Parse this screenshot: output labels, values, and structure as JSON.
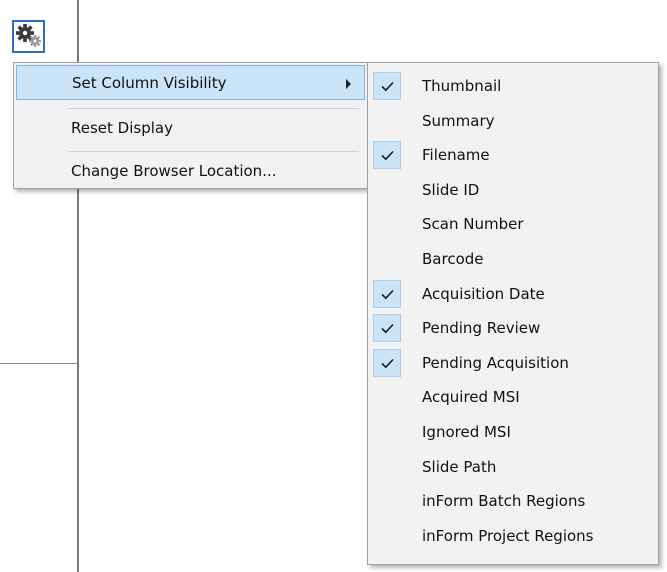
{
  "menu": {
    "items": [
      {
        "label": "Set Column Visibility",
        "has_submenu": true,
        "highlighted": true
      },
      {
        "label": "Reset Display"
      },
      {
        "label": "Change Browser Location..."
      }
    ]
  },
  "column_visibility": {
    "items": [
      {
        "label": "Thumbnail",
        "checked": true
      },
      {
        "label": "Summary",
        "checked": false
      },
      {
        "label": "Filename",
        "checked": true
      },
      {
        "label": "Slide ID",
        "checked": false
      },
      {
        "label": "Scan Number",
        "checked": false
      },
      {
        "label": "Barcode",
        "checked": false
      },
      {
        "label": "Acquisition Date",
        "checked": true
      },
      {
        "label": "Pending Review",
        "checked": true
      },
      {
        "label": "Pending Acquisition",
        "checked": true
      },
      {
        "label": "Acquired MSI",
        "checked": false
      },
      {
        "label": "Ignored MSI",
        "checked": false
      },
      {
        "label": "Slide Path",
        "checked": false
      },
      {
        "label": "inForm Batch Regions",
        "checked": false
      },
      {
        "label": "inForm Project Regions",
        "checked": false
      }
    ]
  },
  "colors": {
    "highlight": "#cce4f7",
    "highlight_border": "#7eb4ea",
    "menu_background": "#f2f2f2",
    "gear_button_border": "#2f6fc0"
  },
  "icons": {
    "settings": "gears-icon",
    "submenu": "chevron-right-icon",
    "check": "check-icon"
  }
}
